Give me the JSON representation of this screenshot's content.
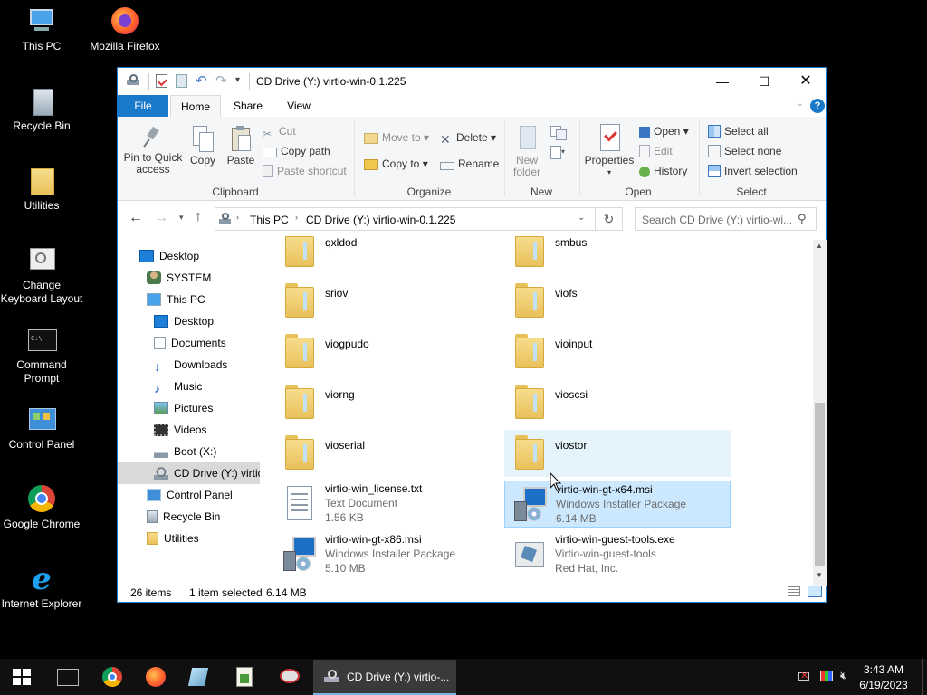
{
  "desktop": {
    "icons": [
      {
        "label1": "This PC",
        "label2": ""
      },
      {
        "label1": "Mozilla Firefox",
        "label2": ""
      },
      {
        "label1": "Recycle Bin",
        "label2": ""
      },
      {
        "label1": "Utilities",
        "label2": ""
      },
      {
        "label1": "Change",
        "label2": "Keyboard Layout"
      },
      {
        "label1": "Command",
        "label2": "Prompt"
      },
      {
        "label1": "Control Panel",
        "label2": ""
      },
      {
        "label1": "Google Chrome",
        "label2": ""
      },
      {
        "label1": "Internet Explorer",
        "label2": ""
      }
    ]
  },
  "window": {
    "title": "CD Drive (Y:) virtio-win-0.1.225",
    "controls": {
      "minimize": "—",
      "maximize": "☐",
      "close": "✕"
    }
  },
  "menubar": {
    "file": "File",
    "home": "Home",
    "share": "Share",
    "view": "View",
    "help": "?"
  },
  "ribbon": {
    "clipboard": {
      "pin_line1": "Pin to Quick",
      "pin_line2": "access",
      "copy": "Copy",
      "paste": "Paste",
      "cut": "Cut",
      "copy_path": "Copy path",
      "paste_shortcut": "Paste shortcut",
      "label": "Clipboard"
    },
    "organize": {
      "move_to": "Move to ▾",
      "copy_to": "Copy to ▾",
      "delete": "Delete ▾",
      "rename": "Rename",
      "label": "Organize"
    },
    "new": {
      "new_folder_line1": "New",
      "new_folder_line2": "folder",
      "label": "New"
    },
    "open": {
      "properties": "Properties",
      "open": "Open ▾",
      "edit": "Edit",
      "history": "History",
      "label": "Open"
    },
    "select": {
      "select_all": "Select all",
      "select_none": "Select none",
      "invert": "Invert selection",
      "label": "Select"
    }
  },
  "address": {
    "crumb1": "This PC",
    "crumb2": "CD Drive (Y:) virtio-win-0.1.225",
    "search_placeholder": "Search CD Drive (Y:) virtio-wi..."
  },
  "nav_pane": [
    "Desktop",
    "SYSTEM",
    "This PC",
    "Desktop",
    "Documents",
    "Downloads",
    "Music",
    "Pictures",
    "Videos",
    "Boot (X:)",
    "CD Drive (Y:) virtio",
    "Control Panel",
    "Recycle Bin",
    "Utilities"
  ],
  "files": {
    "folders": [
      "qxldod",
      "smbus",
      "sriov",
      "viofs",
      "viogpudo",
      "vioinput",
      "viorng",
      "vioscsi",
      "vioserial",
      "viostor"
    ],
    "license": {
      "name": "virtio-win_license.txt",
      "type": "Text Document",
      "size": "1.56 KB"
    },
    "msi64": {
      "name": "virtio-win-gt-x64.msi",
      "type": "Windows Installer Package",
      "size": "6.14 MB"
    },
    "msi86": {
      "name": "virtio-win-gt-x86.msi",
      "type": "Windows Installer Package",
      "size": "5.10 MB"
    },
    "guest": {
      "name": "virtio-win-guest-tools.exe",
      "type": "Virtio-win-guest-tools",
      "size": "Red Hat, Inc."
    }
  },
  "status": {
    "count": "26 items",
    "selected": "1 item selected",
    "size": "6.14 MB"
  },
  "taskbar": {
    "active_window": "CD Drive (Y:) virtio-...",
    "time": "3:43 AM",
    "date": "6/19/2023"
  }
}
